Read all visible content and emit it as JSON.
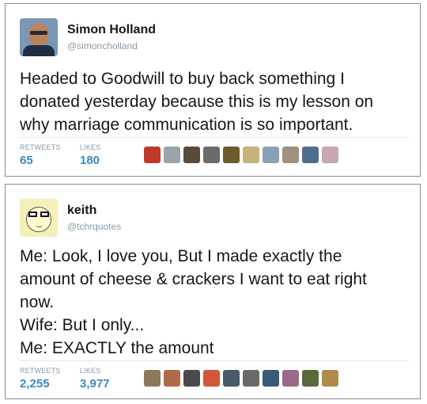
{
  "tweets": [
    {
      "name": "Simon Holland",
      "handle": "@simoncholland",
      "lines": [
        "Headed to Goodwill to buy back something I",
        "donated yesterday because this is my lesson on",
        "why marriage communication is so important."
      ],
      "retweets_label": "RETWEETS",
      "retweets": "65",
      "likes_label": "LIKES",
      "likes": "180",
      "liker_colors": [
        "#c0392b",
        "#9aa5a8",
        "#5a4a3a",
        "#6b6b6b",
        "#6d5a2a",
        "#c8b27a",
        "#8aa0b8",
        "#a09080",
        "#4e6e8e",
        "#c9a6b0"
      ]
    },
    {
      "name": "keith",
      "handle": "@tchrquotes",
      "lines": [
        "Me: Look, I love you, But I made exactly the",
        "amount of cheese & crackers I want to eat right",
        "now.",
        "Wife: But I only...",
        "Me: EXACTLY the amount"
      ],
      "retweets_label": "RETWEETS",
      "retweets": "2,255",
      "likes_label": "LIKES",
      "likes": "3,977",
      "liker_colors": [
        "#8a7a5a",
        "#b06a4a",
        "#4a4a4a",
        "#d2573a",
        "#4a5a6a",
        "#6a6a6a",
        "#3a5a7a",
        "#9a6a8a",
        "#5a6a3a",
        "#b08a4a"
      ]
    }
  ]
}
